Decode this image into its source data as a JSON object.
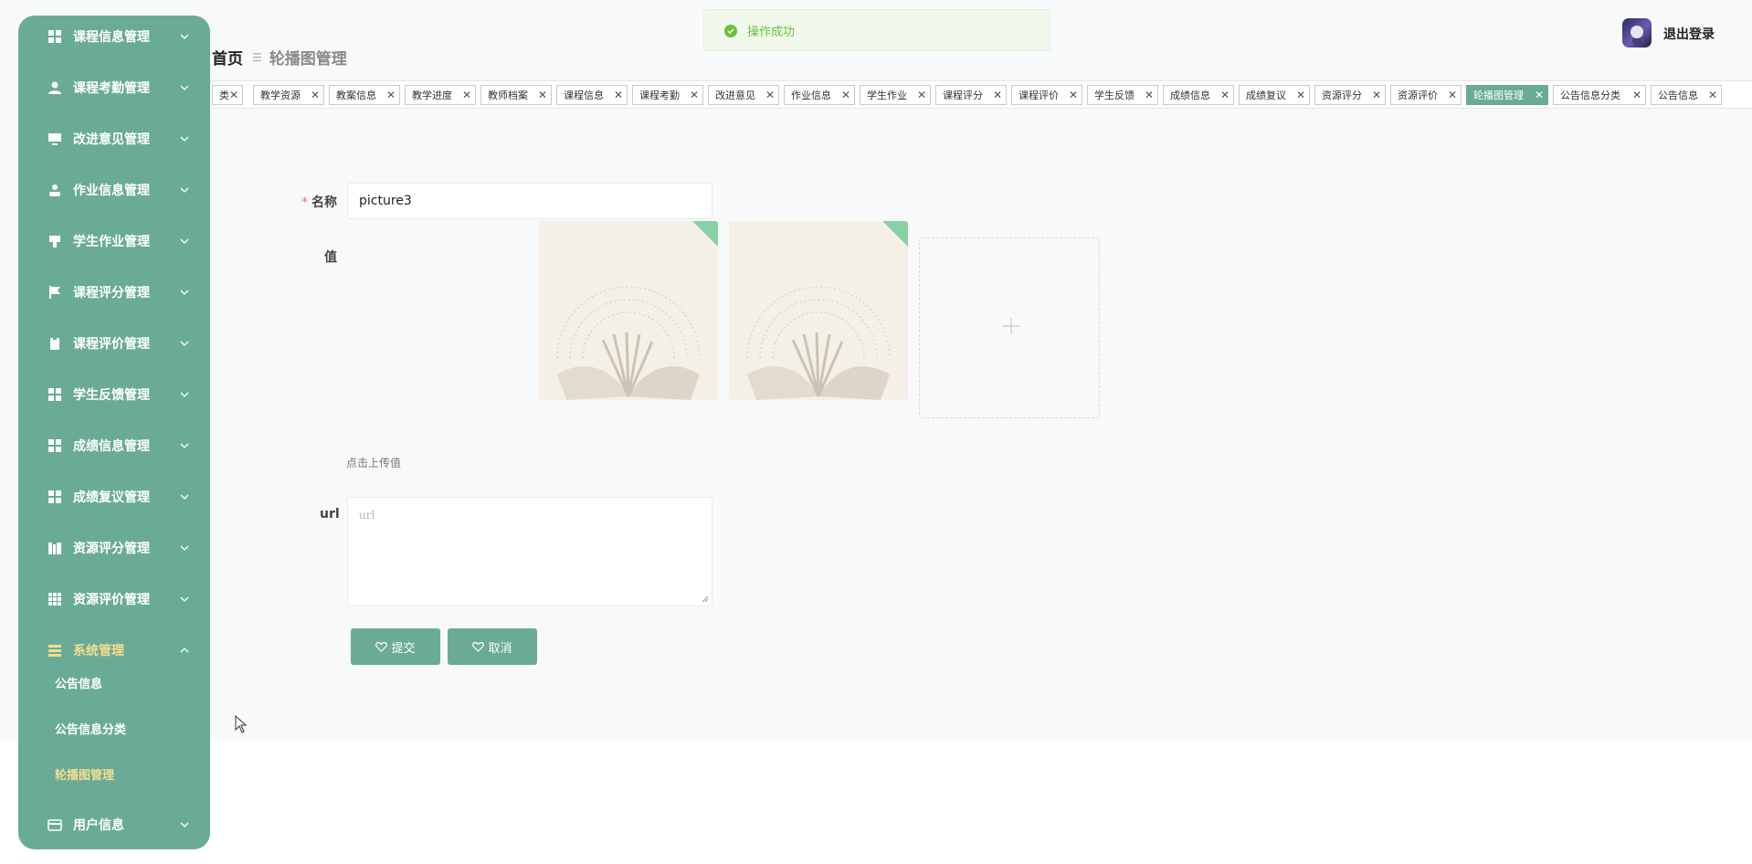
{
  "toast": {
    "message": "操作成功"
  },
  "header": {
    "logout_label": "退出登录"
  },
  "breadcrumb": {
    "home": "首页",
    "current": "轮播图管理"
  },
  "sidebar": {
    "items": [
      {
        "label": "课程信息管理",
        "icon": "grid-icon"
      },
      {
        "label": "课程考勤管理",
        "icon": "user-icon"
      },
      {
        "label": "改进意见管理",
        "icon": "monitor-icon"
      },
      {
        "label": "作业信息管理",
        "icon": "person-icon"
      },
      {
        "label": "学生作业管理",
        "icon": "brush-icon"
      },
      {
        "label": "课程评分管理",
        "icon": "flag-icon"
      },
      {
        "label": "课程评价管理",
        "icon": "clipboard-icon"
      },
      {
        "label": "学生反馈管理",
        "icon": "grid-icon"
      },
      {
        "label": "成绩信息管理",
        "icon": "grid-icon"
      },
      {
        "label": "成绩复议管理",
        "icon": "grid-icon"
      },
      {
        "label": "资源评分管理",
        "icon": "books-icon"
      },
      {
        "label": "资源评价管理",
        "icon": "apps-icon"
      },
      {
        "label": "系统管理",
        "icon": "list-icon"
      },
      {
        "label": "用户信息",
        "icon": "card-icon"
      }
    ],
    "sub_items": [
      {
        "label": "公告信息"
      },
      {
        "label": "公告信息分类"
      },
      {
        "label": "轮播图管理"
      }
    ]
  },
  "tags": [
    {
      "label": "类"
    },
    {
      "label": "教学资源"
    },
    {
      "label": "教案信息"
    },
    {
      "label": "教学进度"
    },
    {
      "label": "教师档案"
    },
    {
      "label": "课程信息"
    },
    {
      "label": "课程考勤"
    },
    {
      "label": "改进意见"
    },
    {
      "label": "作业信息"
    },
    {
      "label": "学生作业"
    },
    {
      "label": "课程评分"
    },
    {
      "label": "课程评价"
    },
    {
      "label": "学生反馈"
    },
    {
      "label": "成绩信息"
    },
    {
      "label": "成绩复议"
    },
    {
      "label": "资源评分"
    },
    {
      "label": "资源评价"
    },
    {
      "label": "轮播图管理",
      "active": true
    },
    {
      "label": "公告信息分类"
    },
    {
      "label": "公告信息"
    }
  ],
  "form": {
    "name_label": "名称",
    "name_required": "*",
    "name_value": "picture3",
    "value_label": "值",
    "upload_tip": "点击上传值",
    "url_label": "url",
    "url_placeholder": "url",
    "submit_label": "提交",
    "cancel_label": "取消"
  },
  "colors": {
    "accent": "#6aab98",
    "active_text": "#f5dd8f",
    "success": "#67c23a",
    "required": "#f56c6c"
  }
}
